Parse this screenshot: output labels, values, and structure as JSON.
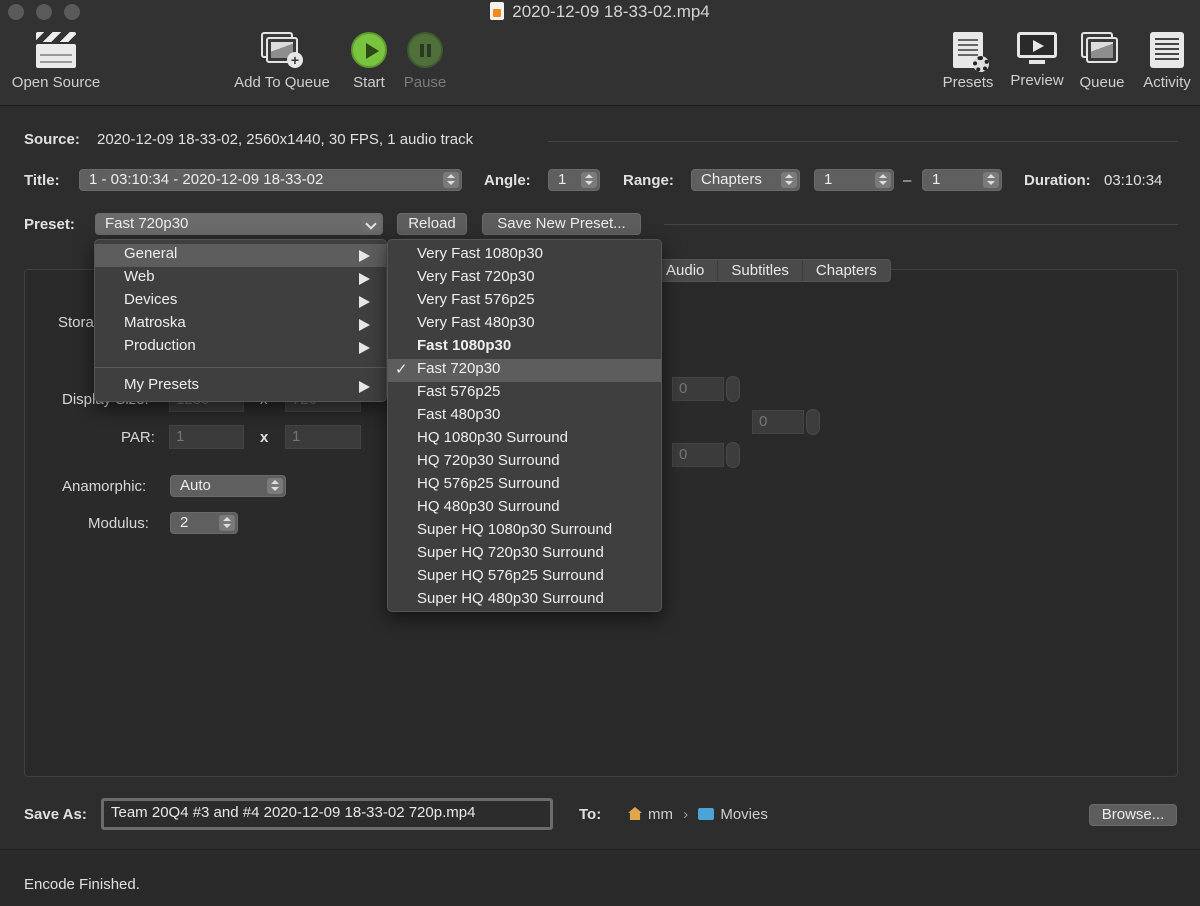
{
  "window": {
    "title": "2020-12-09 18-33-02.mp4"
  },
  "toolbar": {
    "open_source": "Open Source",
    "add_to_queue": "Add To Queue",
    "start": "Start",
    "pause": "Pause",
    "presets": "Presets",
    "preview": "Preview",
    "queue": "Queue",
    "activity": "Activity"
  },
  "source": {
    "label": "Source:",
    "value": "2020-12-09 18-33-02, 2560x1440, 30 FPS, 1 audio track"
  },
  "title_row": {
    "title_label": "Title:",
    "title_value": "1 - 03:10:34 - 2020-12-09 18-33-02",
    "angle_label": "Angle:",
    "angle_value": "1",
    "range_label": "Range:",
    "range_type": "Chapters",
    "range_start": "1",
    "range_dash": "–",
    "range_end": "1",
    "duration_label": "Duration:",
    "duration_value": "03:10:34"
  },
  "preset_row": {
    "label": "Preset:",
    "value": "Fast 720p30",
    "reload": "Reload",
    "save_new": "Save New Preset..."
  },
  "tabs": [
    "Audio",
    "Subtitles",
    "Chapters"
  ],
  "dimensions": {
    "storage_label": "Stora",
    "display_size_label": "Display Size:",
    "display_w": "1280",
    "display_x": "x",
    "display_h": "720",
    "par_label": "PAR:",
    "par_w": "1",
    "par_x": "x",
    "par_h": "1",
    "anamorphic_label": "Anamorphic:",
    "anamorphic_value": "Auto",
    "modulus_label": "Modulus:",
    "modulus_value": "2",
    "crop_top": "0",
    "crop_right": "0",
    "crop_bottom": "0"
  },
  "preset_menu": {
    "categories": [
      "General",
      "Web",
      "Devices",
      "Matroska",
      "Production"
    ],
    "my_presets": "My Presets",
    "general_items": [
      "Very Fast 1080p30",
      "Very Fast 720p30",
      "Very Fast 576p25",
      "Very Fast 480p30",
      "Fast 1080p30",
      "Fast 720p30",
      "Fast 576p25",
      "Fast 480p30",
      "HQ 1080p30 Surround",
      "HQ 720p30 Surround",
      "HQ 576p25 Surround",
      "HQ 480p30 Surround",
      "Super HQ 1080p30 Surround",
      "Super HQ 720p30 Surround",
      "Super HQ 576p25 Surround",
      "Super HQ 480p30 Surround"
    ],
    "checkmark": "✓"
  },
  "save_row": {
    "save_as_label": "Save As:",
    "filename": "Team 20Q4 #3 and #4 2020-12-09 18-33-02 720p.mp4",
    "to_label": "To:",
    "path_home": "mm",
    "path_sep": "›",
    "path_folder": "Movies",
    "browse": "Browse..."
  },
  "status": {
    "text": "Encode Finished."
  }
}
